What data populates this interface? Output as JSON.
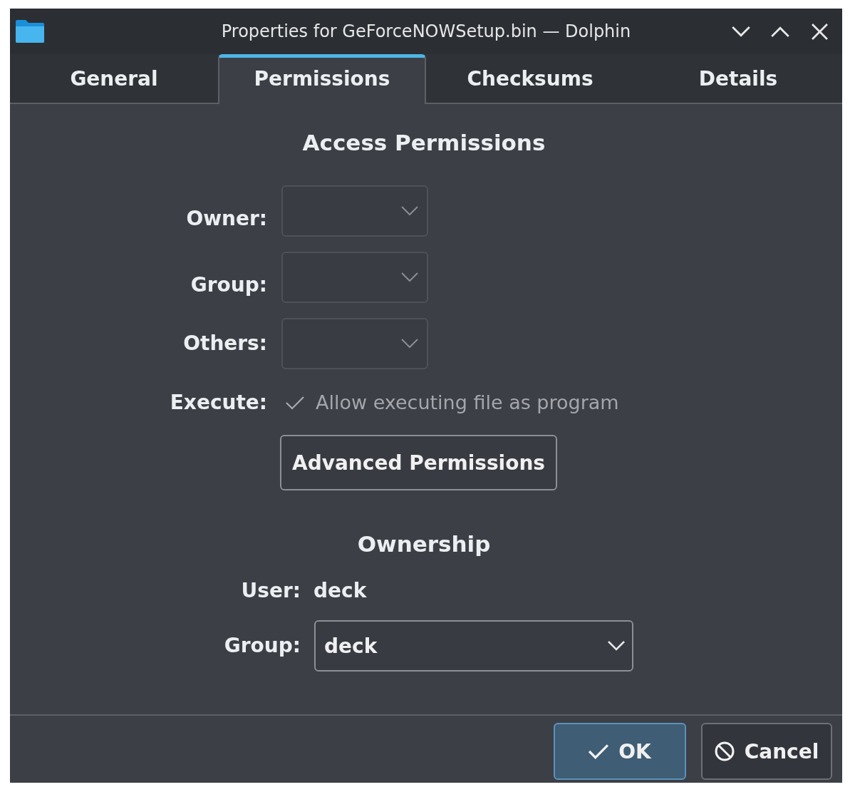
{
  "window": {
    "title": "Properties for GeForceNOWSetup.bin — Dolphin"
  },
  "tabs": [
    {
      "label": "General",
      "selected": false
    },
    {
      "label": "Permissions",
      "selected": true
    },
    {
      "label": "Checksums",
      "selected": false
    },
    {
      "label": "Details",
      "selected": false
    }
  ],
  "access_permissions": {
    "heading": "Access Permissions",
    "dropdowns": [
      {
        "label": "Owner:",
        "disabled": true
      },
      {
        "label": "Group:",
        "disabled": true
      },
      {
        "label": "Others:",
        "disabled": true
      }
    ],
    "execute": {
      "label": "Execute:",
      "text": "Allow executing file as program",
      "checked": true,
      "disabled": true
    },
    "advanced_button": {
      "label": "Advanced Permissions"
    }
  },
  "ownership": {
    "heading": "Ownership",
    "user": {
      "label": "User:",
      "value": "deck"
    },
    "group": {
      "label": "Group:",
      "value": "deck",
      "disabled": false
    }
  },
  "buttons": [
    {
      "kind": "ok",
      "label": "OK",
      "default": true
    },
    {
      "kind": "cancel",
      "label": "Cancel",
      "default": false
    }
  ]
}
